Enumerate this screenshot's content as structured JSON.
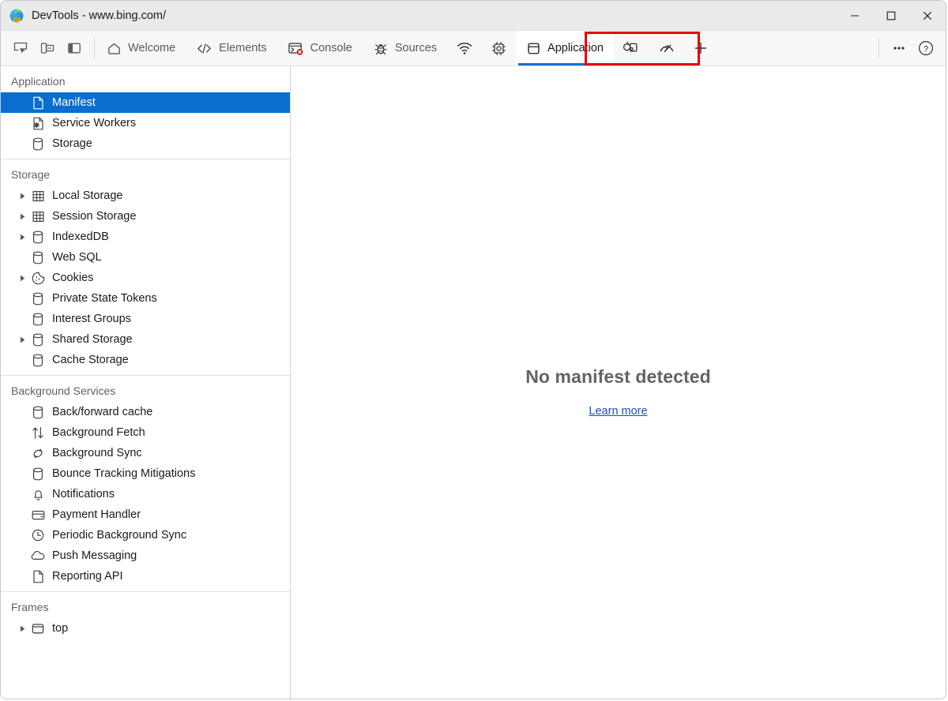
{
  "window": {
    "title": "DevTools - www.bing.com/",
    "logo_icon": "edge-devtools-logo",
    "controls": [
      {
        "name": "minimize-button",
        "icon": "minimize-icon"
      },
      {
        "name": "maximize-button",
        "icon": "maximize-icon"
      },
      {
        "name": "close-button",
        "icon": "close-icon"
      }
    ]
  },
  "toolbar": {
    "left_tools": [
      {
        "name": "inspect-element-button",
        "icon": "inspect-cursor-icon"
      },
      {
        "name": "device-emulation-button",
        "icon": "device-toggle-icon"
      },
      {
        "name": "dock-side-button",
        "icon": "dock-panel-icon"
      }
    ],
    "tabs": [
      {
        "label": "Welcome",
        "icon": "home-icon",
        "active": false
      },
      {
        "label": "Elements",
        "icon": "code-brackets-icon",
        "active": false
      },
      {
        "label": "Console",
        "icon": "console-error-icon",
        "active": false
      },
      {
        "label": "Sources",
        "icon": "bug-icon",
        "active": false
      },
      {
        "label": "",
        "icon": "network-wifi-icon",
        "active": false
      },
      {
        "label": "",
        "icon": "memory-chip-icon",
        "active": false
      },
      {
        "label": "Application",
        "icon": "application-window-icon",
        "active": true
      },
      {
        "label": "",
        "icon": "paint-bucket-icon",
        "active": false
      },
      {
        "label": "",
        "icon": "lighthouse-gauge-icon",
        "active": false
      }
    ],
    "add_tab": {
      "name": "more-tabs-button",
      "icon": "plus-icon"
    },
    "right_tools": [
      {
        "name": "customize-devtools-button",
        "icon": "ellipsis-icon"
      },
      {
        "name": "help-button",
        "icon": "question-circle-icon"
      }
    ],
    "active_tab_underline_color": "#0a6ed1",
    "annotation_box_color": "#e60000"
  },
  "sidebar": {
    "sections": [
      {
        "title": "Application",
        "items": [
          {
            "label": "Manifest",
            "icon": "document-icon",
            "twisty": false,
            "selected": true
          },
          {
            "label": "Service Workers",
            "icon": "service-worker-icon",
            "twisty": false,
            "selected": false
          },
          {
            "label": "Storage",
            "icon": "database-icon",
            "twisty": false,
            "selected": false
          }
        ]
      },
      {
        "title": "Storage",
        "items": [
          {
            "label": "Local Storage",
            "icon": "table-grid-icon",
            "twisty": true,
            "selected": false
          },
          {
            "label": "Session Storage",
            "icon": "table-grid-icon",
            "twisty": true,
            "selected": false
          },
          {
            "label": "IndexedDB",
            "icon": "database-icon",
            "twisty": true,
            "selected": false
          },
          {
            "label": "Web SQL",
            "icon": "database-icon",
            "twisty": false,
            "selected": false
          },
          {
            "label": "Cookies",
            "icon": "cookie-icon",
            "twisty": true,
            "selected": false
          },
          {
            "label": "Private State Tokens",
            "icon": "database-icon",
            "twisty": false,
            "selected": false
          },
          {
            "label": "Interest Groups",
            "icon": "database-icon",
            "twisty": false,
            "selected": false
          },
          {
            "label": "Shared Storage",
            "icon": "database-icon",
            "twisty": true,
            "selected": false
          },
          {
            "label": "Cache Storage",
            "icon": "database-icon",
            "twisty": false,
            "selected": false
          }
        ]
      },
      {
        "title": "Background Services",
        "items": [
          {
            "label": "Back/forward cache",
            "icon": "database-icon",
            "twisty": false,
            "selected": false
          },
          {
            "label": "Background Fetch",
            "icon": "arrows-updown-icon",
            "twisty": false,
            "selected": false
          },
          {
            "label": "Background Sync",
            "icon": "sync-circular-icon",
            "twisty": false,
            "selected": false
          },
          {
            "label": "Bounce Tracking Mitigations",
            "icon": "database-icon",
            "twisty": false,
            "selected": false
          },
          {
            "label": "Notifications",
            "icon": "bell-icon",
            "twisty": false,
            "selected": false
          },
          {
            "label": "Payment Handler",
            "icon": "credit-card-icon",
            "twisty": false,
            "selected": false
          },
          {
            "label": "Periodic Background Sync",
            "icon": "clock-icon",
            "twisty": false,
            "selected": false
          },
          {
            "label": "Push Messaging",
            "icon": "cloud-icon",
            "twisty": false,
            "selected": false
          },
          {
            "label": "Reporting API",
            "icon": "document-icon",
            "twisty": false,
            "selected": false
          }
        ]
      },
      {
        "title": "Frames",
        "items": [
          {
            "label": "top",
            "icon": "frame-window-icon",
            "twisty": true,
            "selected": false
          }
        ]
      }
    ]
  },
  "main": {
    "empty_title": "No manifest detected",
    "learn_more_label": "Learn more"
  }
}
